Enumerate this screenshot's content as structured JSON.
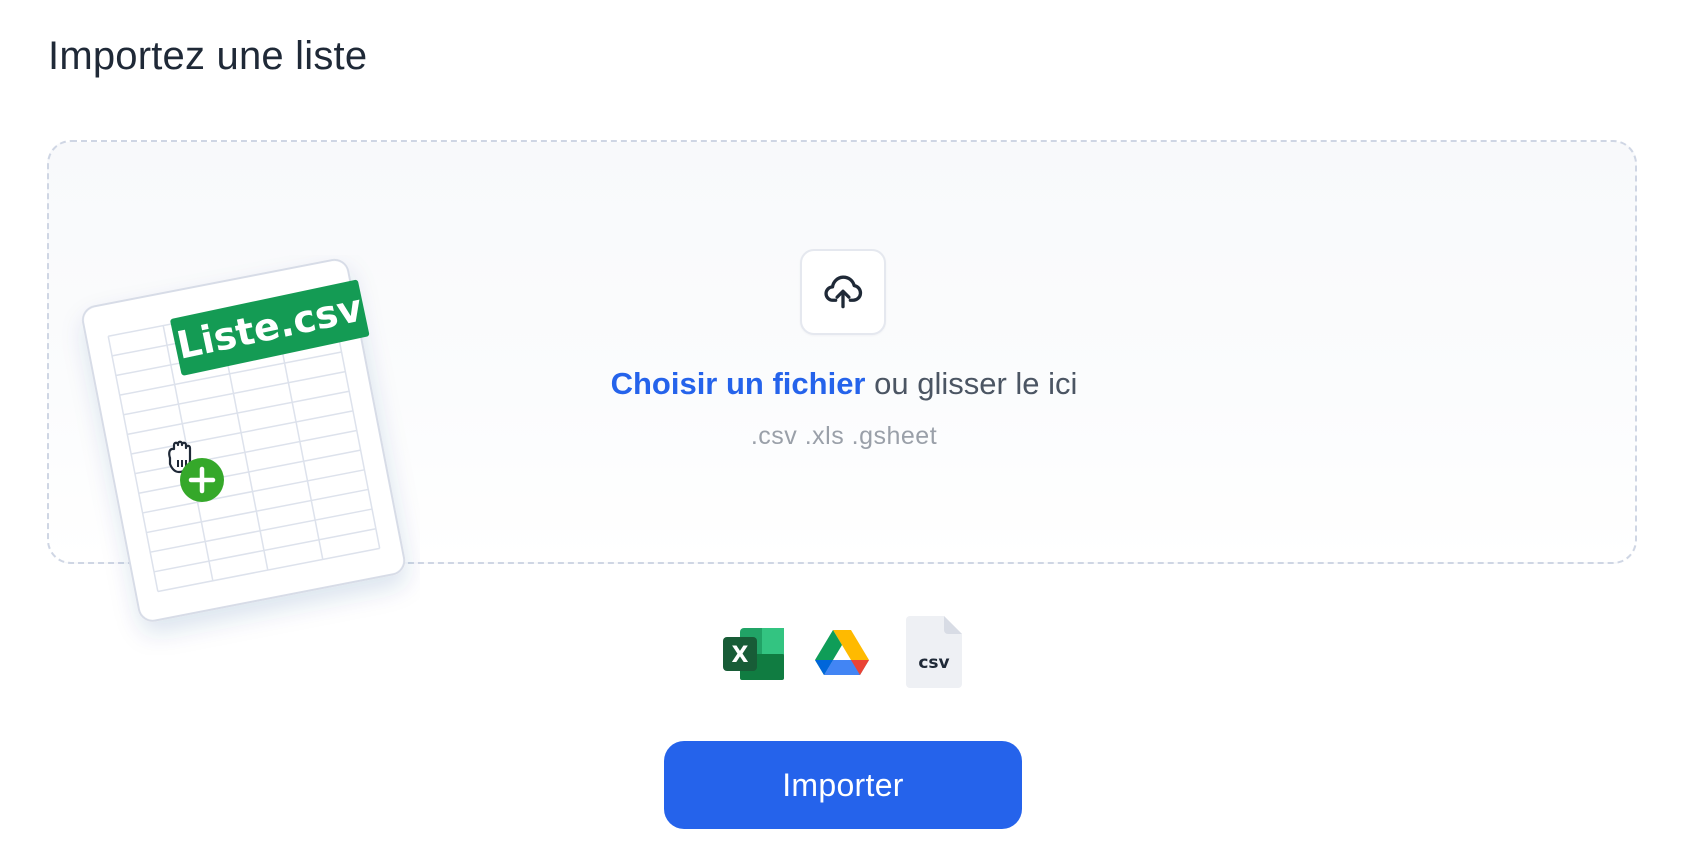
{
  "header": {
    "title": "Importez une liste"
  },
  "dropzone": {
    "upload_icon": "cloud-upload-icon",
    "choose_link": "Choisir un fichier",
    "drop_text": " ou glisser le ici",
    "formats": ".csv .xls .gsheet"
  },
  "illustration": {
    "file_label": "Liste.csv",
    "icons": [
      "spreadsheet-sheet",
      "grab-hand-icon",
      "plus-icon"
    ]
  },
  "sources": [
    {
      "name": "excel-icon",
      "text": "X"
    },
    {
      "name": "google-drive-icon"
    },
    {
      "name": "csv-file-icon",
      "text": "csv"
    }
  ],
  "actions": {
    "import_label": "Importer"
  },
  "colors": {
    "primary": "#2563eb",
    "title": "#1f2937",
    "label_green": "#149b54",
    "plus_green": "#35a82a",
    "dashed_border": "#cfd6e4"
  }
}
